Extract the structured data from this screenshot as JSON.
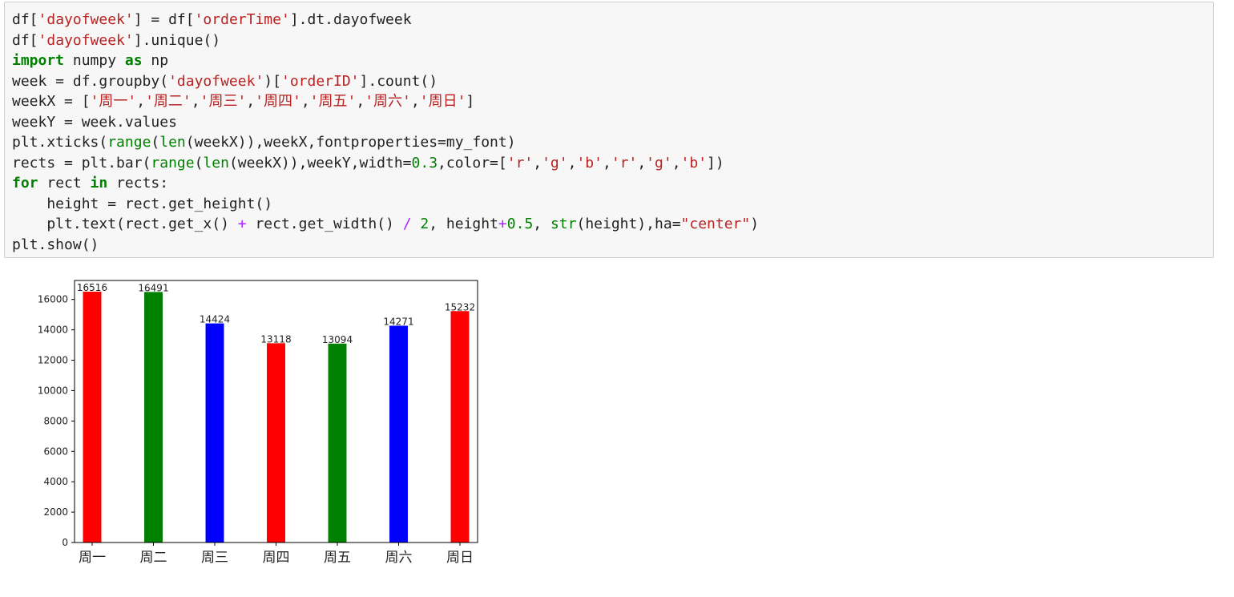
{
  "code_cell": {
    "lines": [
      [
        {
          "t": "df[",
          "c": ""
        },
        {
          "t": "'dayofweek'",
          "c": "s"
        },
        {
          "t": "] = df[",
          "c": ""
        },
        {
          "t": "'orderTime'",
          "c": "s"
        },
        {
          "t": "].dt.dayofweek",
          "c": ""
        }
      ],
      [
        {
          "t": "df[",
          "c": ""
        },
        {
          "t": "'dayofweek'",
          "c": "s"
        },
        {
          "t": "].unique()",
          "c": ""
        }
      ],
      [
        {
          "t": "import",
          "c": "k"
        },
        {
          "t": " numpy ",
          "c": ""
        },
        {
          "t": "as",
          "c": "k"
        },
        {
          "t": " np",
          "c": ""
        }
      ],
      [
        {
          "t": "week = df.groupby(",
          "c": ""
        },
        {
          "t": "'dayofweek'",
          "c": "s"
        },
        {
          "t": ")[",
          "c": ""
        },
        {
          "t": "'orderID'",
          "c": "s"
        },
        {
          "t": "].count()",
          "c": ""
        }
      ],
      [
        {
          "t": "weekX = [",
          "c": ""
        },
        {
          "t": "'周一'",
          "c": "s"
        },
        {
          "t": ",",
          "c": ""
        },
        {
          "t": "'周二'",
          "c": "s"
        },
        {
          "t": ",",
          "c": ""
        },
        {
          "t": "'周三'",
          "c": "s"
        },
        {
          "t": ",",
          "c": ""
        },
        {
          "t": "'周四'",
          "c": "s"
        },
        {
          "t": ",",
          "c": ""
        },
        {
          "t": "'周五'",
          "c": "s"
        },
        {
          "t": ",",
          "c": ""
        },
        {
          "t": "'周六'",
          "c": "s"
        },
        {
          "t": ",",
          "c": ""
        },
        {
          "t": "'周日'",
          "c": "s"
        },
        {
          "t": "]",
          "c": ""
        }
      ],
      [
        {
          "t": "weekY = week.values",
          "c": ""
        }
      ],
      [
        {
          "t": "plt.xticks(",
          "c": ""
        },
        {
          "t": "range",
          "c": "b"
        },
        {
          "t": "(",
          "c": ""
        },
        {
          "t": "len",
          "c": "b"
        },
        {
          "t": "(weekX)),weekX,fontproperties=my_font)",
          "c": ""
        }
      ],
      [
        {
          "t": "rects = plt.bar(",
          "c": ""
        },
        {
          "t": "range",
          "c": "b"
        },
        {
          "t": "(",
          "c": ""
        },
        {
          "t": "len",
          "c": "b"
        },
        {
          "t": "(weekX)),weekY,width=",
          "c": ""
        },
        {
          "t": "0.3",
          "c": "n"
        },
        {
          "t": ",color=[",
          "c": ""
        },
        {
          "t": "'r'",
          "c": "s"
        },
        {
          "t": ",",
          "c": ""
        },
        {
          "t": "'g'",
          "c": "s"
        },
        {
          "t": ",",
          "c": ""
        },
        {
          "t": "'b'",
          "c": "s"
        },
        {
          "t": ",",
          "c": ""
        },
        {
          "t": "'r'",
          "c": "s"
        },
        {
          "t": ",",
          "c": ""
        },
        {
          "t": "'g'",
          "c": "s"
        },
        {
          "t": ",",
          "c": ""
        },
        {
          "t": "'b'",
          "c": "s"
        },
        {
          "t": "])",
          "c": ""
        }
      ],
      [
        {
          "t": "for",
          "c": "k"
        },
        {
          "t": " rect ",
          "c": ""
        },
        {
          "t": "in",
          "c": "k"
        },
        {
          "t": " rects:",
          "c": ""
        }
      ],
      [
        {
          "t": "    height = rect.get_height()",
          "c": ""
        }
      ],
      [
        {
          "t": "    plt.text(rect.get_x() ",
          "c": ""
        },
        {
          "t": "+",
          "c": "o"
        },
        {
          "t": " rect.get_width() ",
          "c": ""
        },
        {
          "t": "/",
          "c": "o"
        },
        {
          "t": " ",
          "c": ""
        },
        {
          "t": "2",
          "c": "n"
        },
        {
          "t": ", height",
          "c": ""
        },
        {
          "t": "+",
          "c": "o"
        },
        {
          "t": "0.5",
          "c": "n"
        },
        {
          "t": ", ",
          "c": ""
        },
        {
          "t": "str",
          "c": "b"
        },
        {
          "t": "(height),ha=",
          "c": ""
        },
        {
          "t": "\"center\"",
          "c": "s"
        },
        {
          "t": ")",
          "c": ""
        }
      ],
      [
        {
          "t": "plt.show()",
          "c": ""
        }
      ]
    ]
  },
  "chart_data": {
    "type": "bar",
    "categories": [
      "周一",
      "周二",
      "周三",
      "周四",
      "周五",
      "周六",
      "周日"
    ],
    "values": [
      16516,
      16491,
      14424,
      13118,
      13094,
      14271,
      15232
    ],
    "value_labels": [
      "16516",
      "16491",
      "14424",
      "13118",
      "13094",
      "14271",
      "15232"
    ],
    "colors": [
      "#ff0000",
      "#008000",
      "#0000ff",
      "#ff0000",
      "#008000",
      "#0000ff",
      "#ff0000"
    ],
    "ylim": [
      0,
      17250
    ],
    "yticks": [
      0,
      2000,
      4000,
      6000,
      8000,
      10000,
      12000,
      14000,
      16000
    ],
    "ytick_labels": [
      "0",
      "2000",
      "4000",
      "6000",
      "8000",
      "10000",
      "12000",
      "14000",
      "16000"
    ],
    "title": "",
    "xlabel": "",
    "ylabel": "",
    "grid": false
  }
}
